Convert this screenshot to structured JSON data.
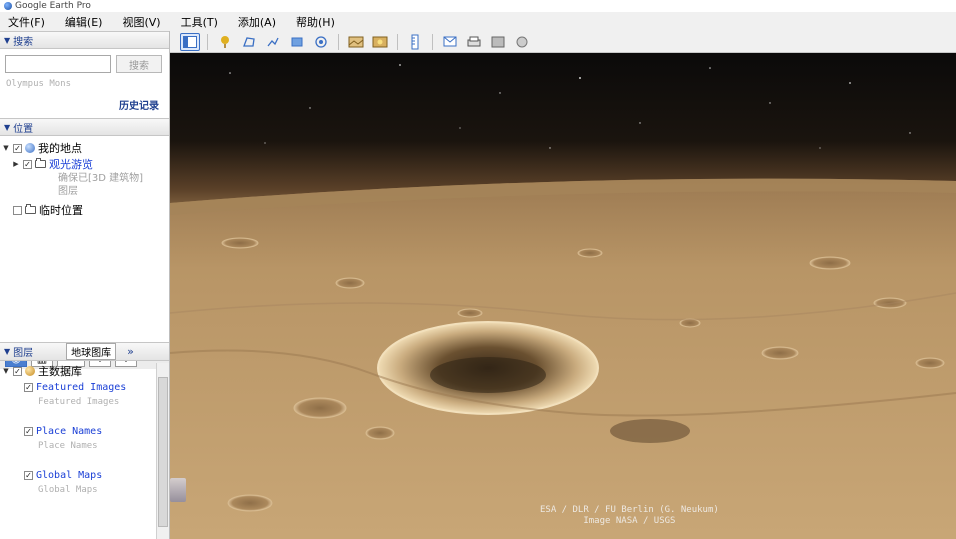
{
  "window": {
    "title": "Google Earth Pro"
  },
  "menu": [
    "文件(F)",
    "编辑(E)",
    "视图(V)",
    "工具(T)",
    "添加(A)",
    "帮助(H)"
  ],
  "toolbar": {
    "icons": [
      "sidebar-toggle-icon",
      "placemark-icon",
      "polygon-icon",
      "path-icon",
      "image-overlay-icon",
      "record-tour-icon",
      "historical-imagery-icon",
      "sun-icon",
      "planets-icon",
      "ruler-icon",
      "email-icon",
      "print-icon",
      "save-image-icon",
      "view-in-maps-icon"
    ]
  },
  "search": {
    "header": "搜索",
    "input_value": "",
    "button": "搜索",
    "hint": "Olympus Mons",
    "history": "历史记录"
  },
  "places": {
    "header": "位置",
    "items": [
      {
        "label": "我的地点",
        "checked": true,
        "expanded": true
      },
      {
        "label": "观光游览",
        "checked": true,
        "sub": "确保已[3D 建筑物]图层"
      },
      {
        "label": "临时位置",
        "checked": false
      }
    ]
  },
  "layers": {
    "header": "图层",
    "tab": "地球图库",
    "more": "»",
    "root": "主数据库",
    "items": [
      {
        "label": "Featured Images",
        "sub": "Featured Images",
        "checked": true
      },
      {
        "label": "Place Names",
        "sub": "Place Names",
        "checked": true
      },
      {
        "label": "Global Maps",
        "sub": "Global Maps",
        "checked": true
      }
    ]
  },
  "mini_toolbar": {
    "add1": "+",
    "add2": "+"
  },
  "viewport": {
    "credit_line1": "ESA / DLR / FU Berlin (G. Neukum)",
    "credit_line2": "Image NASA / USGS"
  },
  "colors": {
    "sky": "#0b0a0a",
    "horizon": "#8a6a45",
    "surface": "#b89566",
    "accent": "#1a3fd6"
  }
}
